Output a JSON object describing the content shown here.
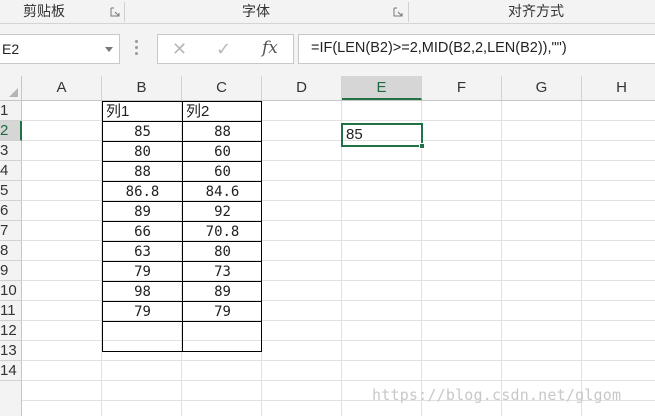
{
  "ribbon": {
    "groups": [
      "剪贴板",
      "字体",
      "对齐方式"
    ]
  },
  "formula_bar": {
    "name_box": "E2",
    "cancel_icon": "✕",
    "enter_icon": "✓",
    "fx_label": "fx",
    "formula": "=IF(LEN(B2)>=2,MID(B2,2,LEN(B2)),\"\")"
  },
  "columns": [
    "A",
    "B",
    "C",
    "D",
    "E",
    "F",
    "G",
    "H"
  ],
  "selected_column": "E",
  "rows": [
    "1",
    "2",
    "3",
    "4",
    "5",
    "6",
    "7",
    "8",
    "9",
    "10",
    "11",
    "12",
    "13",
    "14"
  ],
  "selected_row": "2",
  "table": {
    "headers": [
      "列1",
      "列2"
    ],
    "rows": [
      [
        "85",
        "88"
      ],
      [
        "80",
        "60"
      ],
      [
        "88",
        "60"
      ],
      [
        "86.8",
        "84.6"
      ],
      [
        "89",
        "92"
      ],
      [
        "66",
        "70.8"
      ],
      [
        "63",
        "80"
      ],
      [
        "79",
        "73"
      ],
      [
        "98",
        "89"
      ],
      [
        "79",
        "79"
      ]
    ]
  },
  "active_cell": {
    "ref": "E2",
    "value": "85"
  },
  "watermark": "https://blog.csdn.net/glgom",
  "colors": {
    "accent": "#217346",
    "header_bg": "#f3f3f3",
    "gridline": "#e1e1e1"
  }
}
